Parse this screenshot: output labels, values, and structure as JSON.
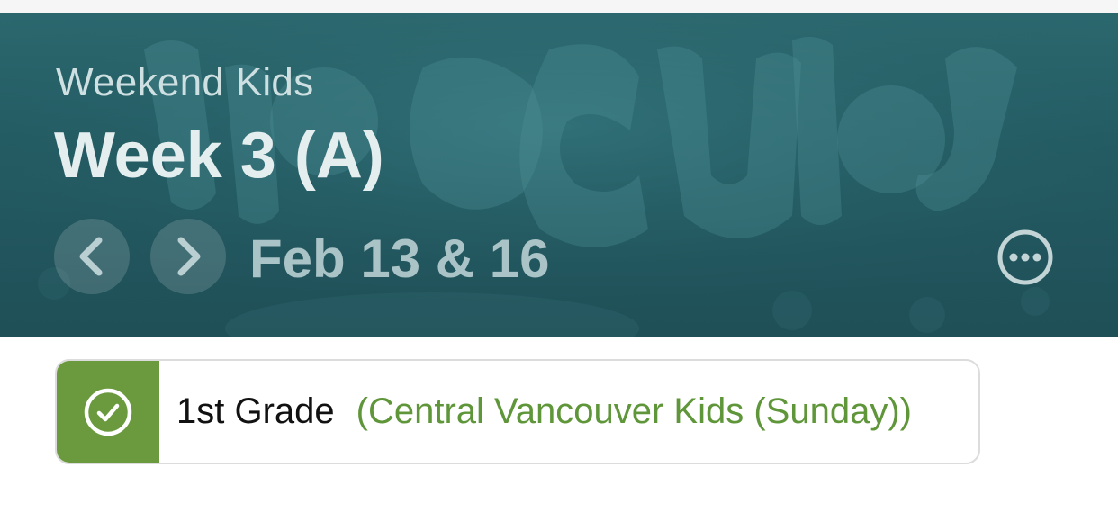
{
  "header": {
    "subtitle": "Weekend Kids",
    "title": "Week 3 (A)",
    "date_range": "Feb 13 & 16",
    "prev_icon": "chevron-left-icon",
    "next_icon": "chevron-right-icon",
    "more_icon": "ellipsis-circle-icon",
    "background_color": "#245c64"
  },
  "card": {
    "status_icon": "check-circle-icon",
    "status_color": "#6a9a3d",
    "grade": "1st Grade",
    "group": "(Central Vancouver Kids (Sunday))",
    "group_color": "#5f963a"
  }
}
